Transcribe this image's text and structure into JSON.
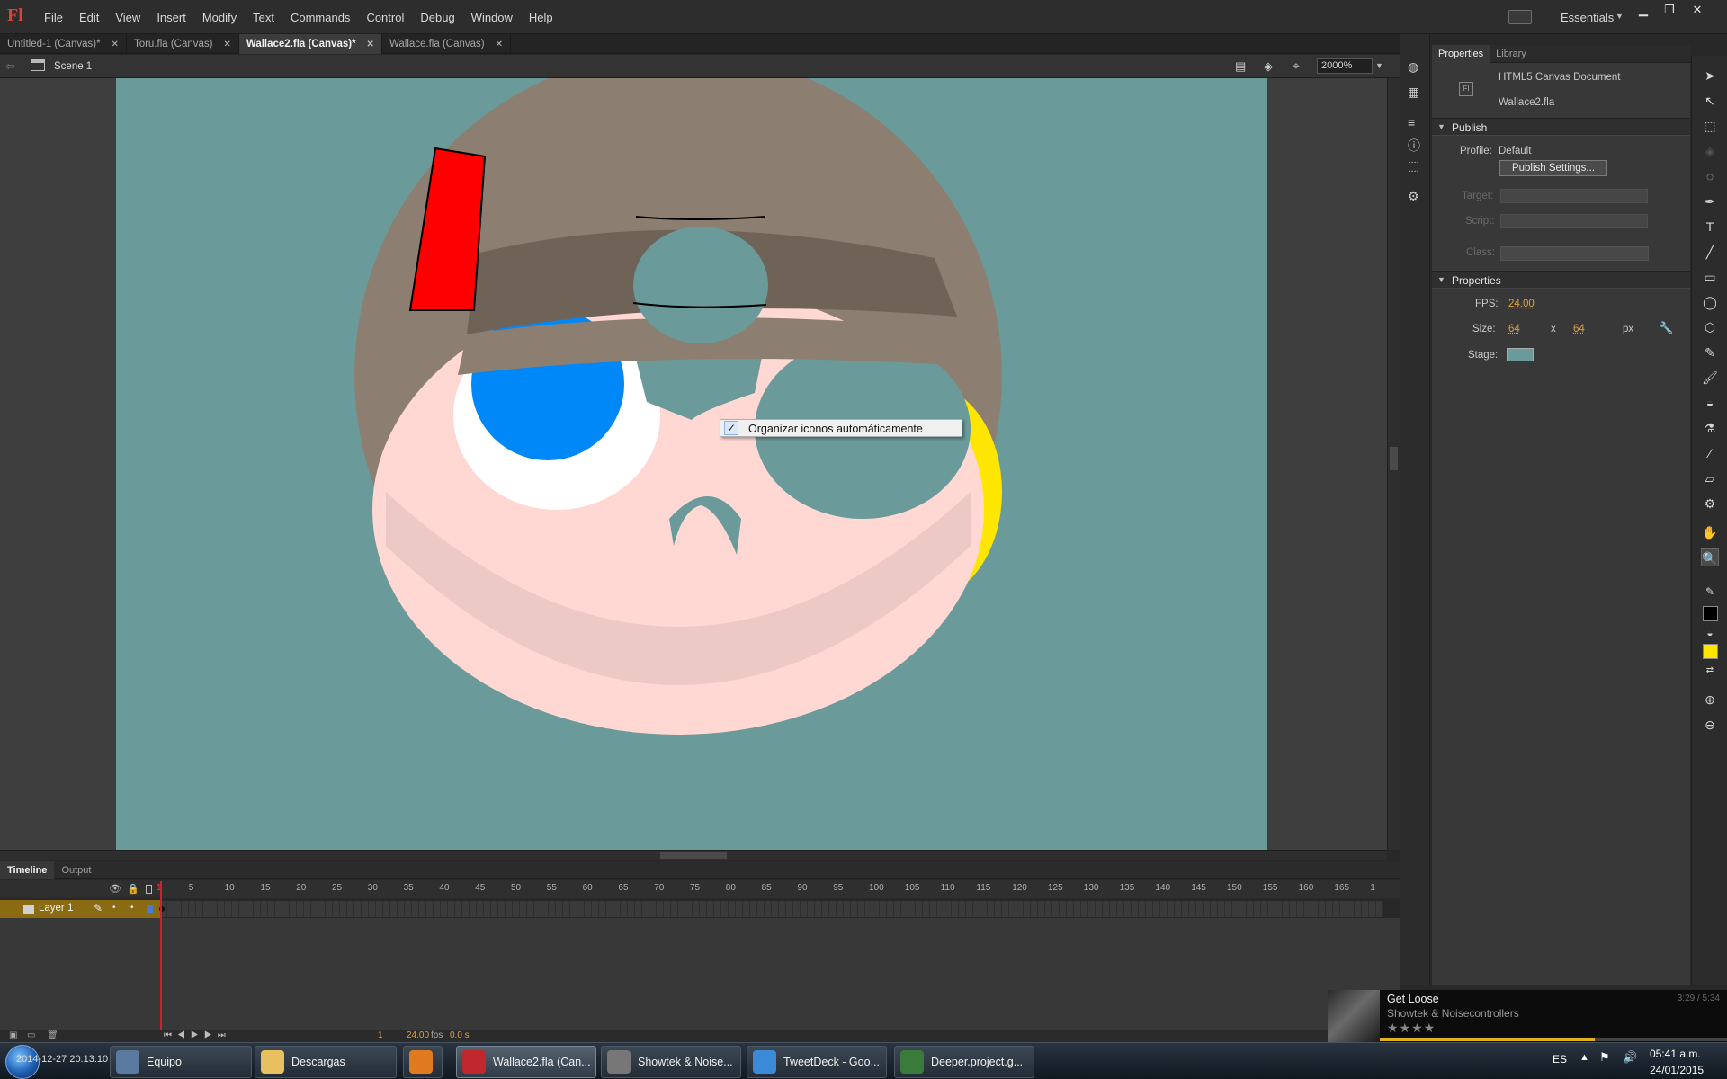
{
  "app": {
    "logo": "Fl"
  },
  "menu": [
    "File",
    "Edit",
    "View",
    "Insert",
    "Modify",
    "Text",
    "Commands",
    "Control",
    "Debug",
    "Window",
    "Help"
  ],
  "workspace": {
    "label": "Essentials"
  },
  "window_controls": {
    "minimize": "▁",
    "restore": "❐",
    "close": "✕"
  },
  "doc_tabs": [
    {
      "label": "Untitled-1 (Canvas)*",
      "active": false
    },
    {
      "label": "Toru.fla (Canvas)",
      "active": false
    },
    {
      "label": "Wallace2.fla (Canvas)*",
      "active": true
    },
    {
      "label": "Wallace.fla (Canvas)",
      "active": false
    }
  ],
  "edit_bar": {
    "scene": "Scene 1",
    "zoom": "2000%"
  },
  "context_menu": {
    "checked": true,
    "label": "Organizar iconos automáticamente"
  },
  "timeline": {
    "tabs": [
      "Timeline",
      "Output"
    ],
    "ruler": [
      "1",
      "5",
      "10",
      "15",
      "20",
      "25",
      "30",
      "35",
      "40",
      "45",
      "50",
      "55",
      "60",
      "65",
      "70",
      "75",
      "80",
      "85",
      "90",
      "95",
      "100",
      "105",
      "110",
      "115",
      "120",
      "125",
      "130",
      "135",
      "140",
      "145",
      "150",
      "155",
      "160",
      "165",
      "1"
    ],
    "layer_name": "Layer 1",
    "current_frame": "1",
    "fps": "24.00",
    "fps_unit": "fps",
    "elapsed": "0.0 s"
  },
  "properties_panel": {
    "tabs": [
      "Properties",
      "Library"
    ],
    "doc_type": "HTML5 Canvas Document",
    "doc_name": "Wallace2.fla",
    "publish": {
      "header": "Publish",
      "profile_label": "Profile:",
      "profile_value": "Default",
      "settings_button": "Publish Settings...",
      "target_label": "Target:",
      "script_label": "Script:",
      "class_label": "Class:"
    },
    "properties": {
      "header": "Properties",
      "fps_label": "FPS:",
      "fps_value": "24.00",
      "size_label": "Size:",
      "width": "64",
      "x": "x",
      "height": "64",
      "unit": "px",
      "stage_label": "Stage:",
      "stage_color": "#6a9a9a"
    }
  },
  "music_widget": {
    "track": "Get Loose",
    "artist": "Showtek & Noisecontrollers",
    "time": "3:29 / 5:34",
    "stars": "★★★★",
    "progress": 0.62
  },
  "taskbar": {
    "desktop_label": "2014-12-27 20:13:10",
    "buttons": [
      {
        "label": "Equipo",
        "icon_color": "#5a7aa0",
        "active": false
      },
      {
        "label": "Descargas",
        "icon_color": "#e8c060",
        "active": false
      },
      {
        "label": "",
        "icon_color": "#e07a20",
        "active": false
      },
      {
        "label": "Wallace2.fla (Can...",
        "icon_color": "#c0282d",
        "active": true
      },
      {
        "label": "Showtek & Noise...",
        "icon_color": "#777777",
        "active": false
      },
      {
        "label": "TweetDeck - Goo...",
        "icon_color": "#3a8ad8",
        "active": false
      },
      {
        "label": "Deeper.project.g...",
        "icon_color": "#3a7a3a",
        "active": false
      }
    ],
    "language": "ES",
    "time": "05:41 a.m.",
    "date": "24/01/2015"
  },
  "colors": {
    "accent_orange": "#e0a23a",
    "layer_highlight": "#8a6b12",
    "stage_bg": "#6a9a9a",
    "fill_swatch": "#ffe600",
    "stroke_swatch": "#000000"
  }
}
